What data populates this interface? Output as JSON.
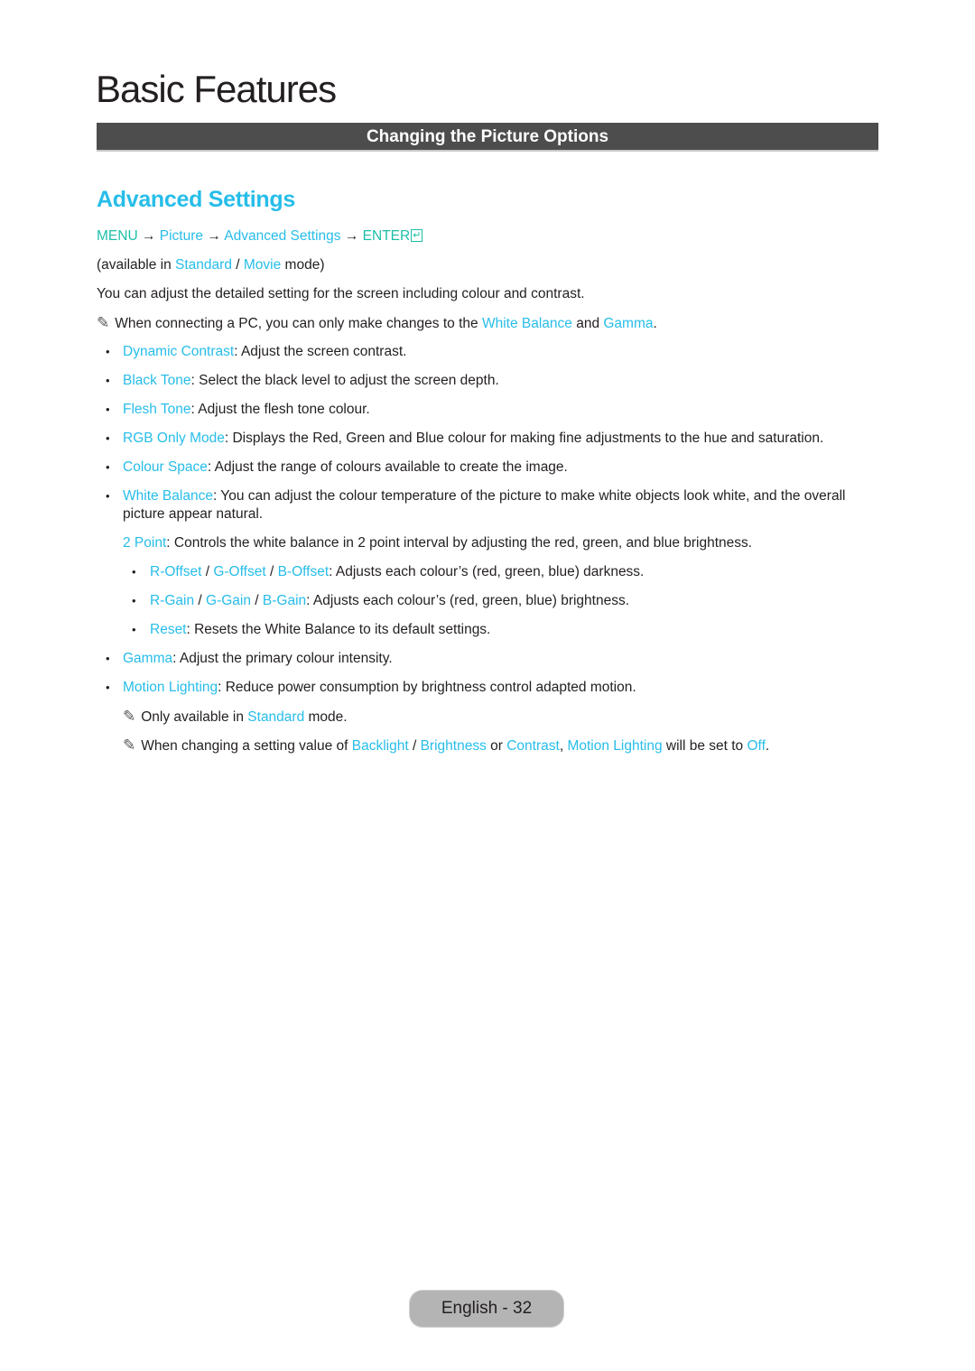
{
  "chapter_title": "Basic Features",
  "section_bar": "Changing the Picture Options",
  "subsection_title": "Advanced Settings",
  "colors": {
    "link": "#27bde9",
    "menu_keyword": "#1dbfa8",
    "bar": "#4d4d4d",
    "text": "#231f20"
  },
  "menu_path": {
    "menu": "MENU",
    "arrow": " → ",
    "picture": "Picture",
    "advanced": "Advanced Settings",
    "enter": "ENTER",
    "enter_icon": "↵"
  },
  "availability": {
    "prefix": "(available in ",
    "standard": "Standard",
    "sep": " / ",
    "movie": "Movie",
    "suffix": " mode)"
  },
  "intro": "You can adjust the detailed setting for the screen including colour and contrast.",
  "pc_note": {
    "icon": "✎",
    "text1": "When connecting a PC, you can only make changes to the ",
    "link1": "White Balance",
    "text2": " and ",
    "link2": "Gamma",
    "text3": "."
  },
  "items": [
    {
      "term": "Dynamic Contrast",
      "desc": ": Adjust the screen contrast."
    },
    {
      "term": "Black Tone",
      "desc": ": Select the black level to adjust the screen depth."
    },
    {
      "term": "Flesh Tone",
      "desc": ": Adjust the flesh tone colour."
    },
    {
      "term": "RGB Only Mode",
      "desc": ": Displays the Red, Green and Blue colour for making fine adjustments to the hue and saturation."
    },
    {
      "term": "Colour Space",
      "desc": ": Adjust the range of colours available to create the image."
    },
    {
      "term": "White Balance",
      "desc": ": You can adjust the colour temperature of the picture to make white objects look white, and the overall picture appear natural."
    }
  ],
  "two_point": {
    "term": "2 Point",
    "desc": ": Controls the white balance in 2 point interval by adjusting the red, green, and blue brightness."
  },
  "sub_items": {
    "offset": {
      "r": "R-Offset",
      "g": "G-Offset",
      "b": "B-Offset",
      "sep": " / ",
      "desc": ": Adjusts each colour’s (red, green, blue) darkness."
    },
    "gain": {
      "r": "R-Gain",
      "g": "G-Gain",
      "b": "B-Gain",
      "sep": " / ",
      "desc": ": Adjusts each colour’s (red, green, blue) brightness."
    },
    "reset": {
      "term": "Reset",
      "desc": ": Resets the White Balance to its default settings."
    }
  },
  "gamma": {
    "term": "Gamma",
    "desc": ": Adjust the primary colour intensity."
  },
  "motion_lighting": {
    "term": "Motion Lighting",
    "desc": ": Reduce power consumption by brightness control adapted motion.",
    "note1": {
      "icon": "✎",
      "text1": "Only available in ",
      "link": "Standard",
      "text2": " mode."
    },
    "note2": {
      "icon": "✎",
      "text1": "When changing a setting value of ",
      "backlight": "Backlight",
      "sep": " / ",
      "brightness": "Brightness",
      "or": " or ",
      "contrast": "Contrast",
      "comma": ", ",
      "motion": "Motion Lighting",
      "text2": " will be set to ",
      "off": "Off",
      "end": "."
    }
  },
  "bullet_char": "•",
  "footer": "English - 32"
}
